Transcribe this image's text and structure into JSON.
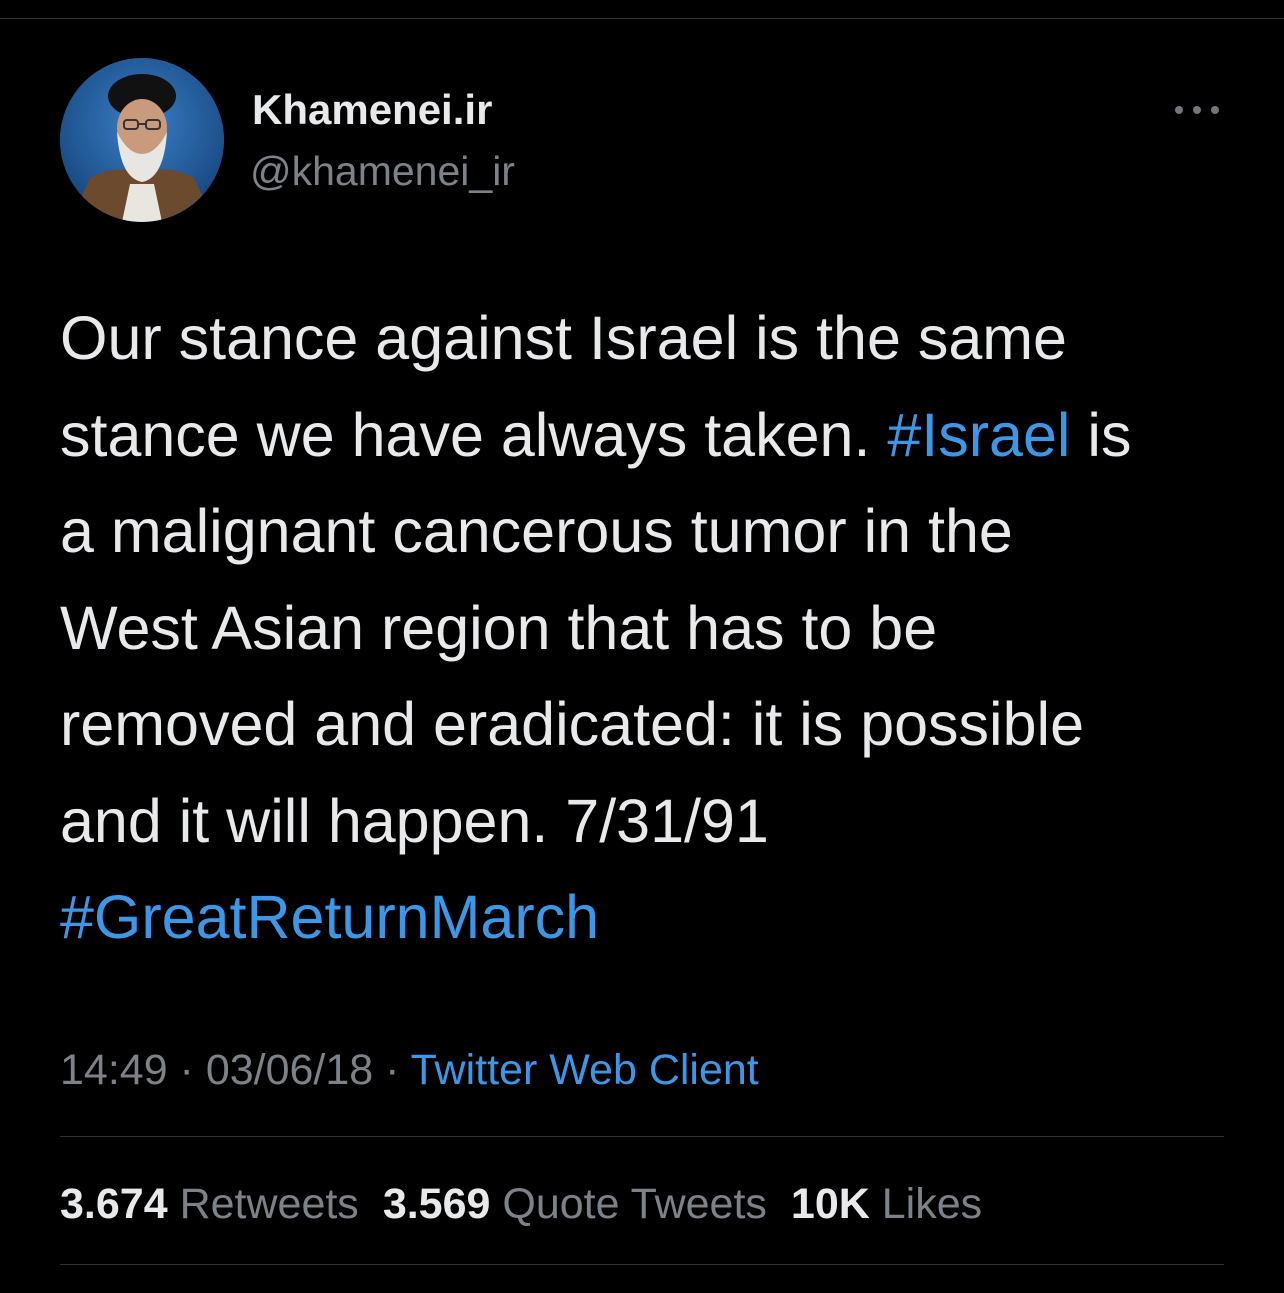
{
  "author": {
    "display_name": "Khamenei.ir",
    "handle": "@khamenei_ir",
    "avatar_icon": "profile-photo"
  },
  "tweet": {
    "lines": [
      [
        {
          "text": "Our stance against Israel is the same",
          "hashtag": false
        }
      ],
      [
        {
          "text": "stance we have always taken. ",
          "hashtag": false
        },
        {
          "text": "#Israel",
          "hashtag": true
        },
        {
          "text": " is",
          "hashtag": false
        }
      ],
      [
        {
          "text": "a malignant cancerous tumor in the",
          "hashtag": false
        }
      ],
      [
        {
          "text": "West Asian region that has to be",
          "hashtag": false
        }
      ],
      [
        {
          "text": "removed and eradicated: it is possible",
          "hashtag": false
        }
      ],
      [
        {
          "text": "and it will happen. 7/31/91",
          "hashtag": false
        }
      ],
      [
        {
          "text": "#GreatReturnMarch",
          "hashtag": true
        }
      ]
    ]
  },
  "meta": {
    "time": "14:49",
    "separator": " · ",
    "date": "03/06/18",
    "source": "Twitter Web Client"
  },
  "stats": {
    "retweets_count": "3.674",
    "retweets_label": "Retweets",
    "quotes_count": "3.569",
    "quotes_label": "Quote Tweets",
    "likes_count": "10K",
    "likes_label": "Likes"
  },
  "colors": {
    "background": "#000000",
    "text": "#e7e9ea",
    "secondary": "#7c8288",
    "link": "#3c98e6",
    "divider": "#2f3336"
  }
}
